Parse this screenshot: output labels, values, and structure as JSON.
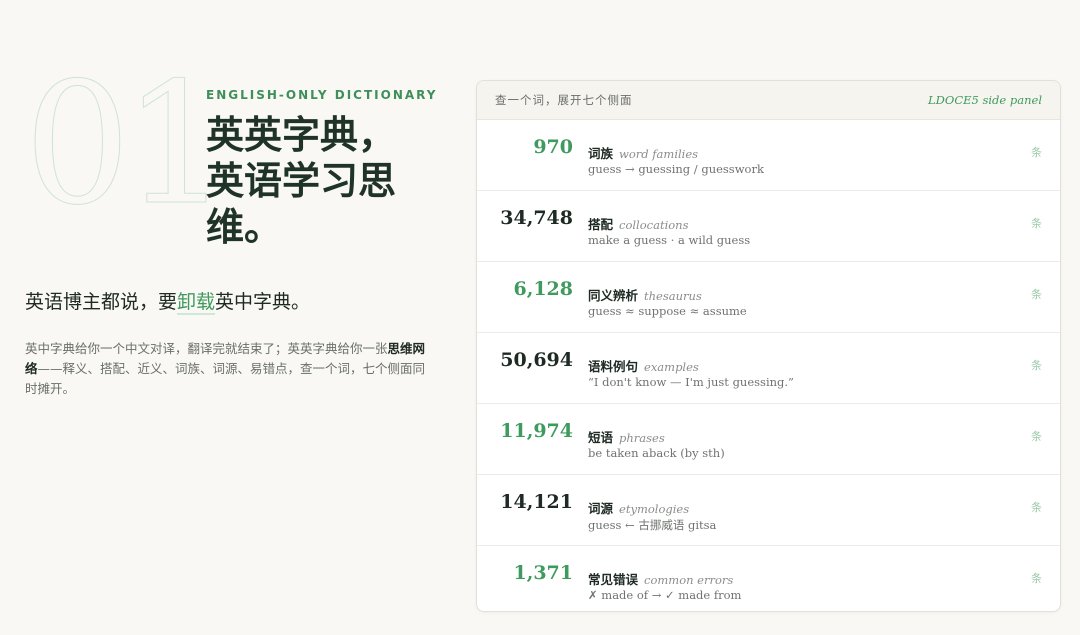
{
  "hero": {
    "number": "01",
    "kicker": "ENGLISH-ONLY DICTIONARY",
    "headline": "英英字典，英语学习思维。"
  },
  "subhead": {
    "prefix": "英语博主都说，要",
    "highlight": "卸载",
    "suffix": "英中字典。"
  },
  "body": {
    "part1": "英中字典给你一个中文对译，翻译完就结束了；英英字典给你一张",
    "bold": "思维网络",
    "part2": "——释义、搭配、近义、词族、词源、易错点，查一个词，七个侧面同时摊开。"
  },
  "panel": {
    "header_left": "查一个词，展开七个侧面",
    "header_right": "LDOCE5 side panel",
    "rows": [
      {
        "count": "970",
        "title": "词族",
        "title_en": "word families",
        "example": "guess → guessing / guesswork",
        "unit": "条",
        "accent": "green"
      },
      {
        "count": "34,748",
        "title": "搭配",
        "title_en": "collocations",
        "example": "make a guess · a wild guess",
        "unit": "条",
        "accent": "dark"
      },
      {
        "count": "6,128",
        "title": "同义辨析",
        "title_en": "thesaurus",
        "example": "guess ≈ suppose ≈ assume",
        "unit": "条",
        "accent": "green"
      },
      {
        "count": "50,694",
        "title": "语料例句",
        "title_en": "examples",
        "example": "“I don't know — I'm just guessing.”",
        "unit": "条",
        "accent": "dark"
      },
      {
        "count": "11,974",
        "title": "短语",
        "title_en": "phrases",
        "example": "be taken aback (by sth)",
        "unit": "条",
        "accent": "green"
      },
      {
        "count": "14,121",
        "title": "词源",
        "title_en": "etymologies",
        "example": "guess ← 古挪威语 gitsa",
        "unit": "条",
        "accent": "dark"
      },
      {
        "count": "1,371",
        "title": "常见错误",
        "title_en": "common errors",
        "example": "✗ made of → ✓ made from",
        "unit": "条",
        "accent": "green"
      }
    ]
  },
  "colors": {
    "accent_green": "#3f9a5e",
    "dark_text": "#1f2a24",
    "background": "#faf8f4"
  }
}
